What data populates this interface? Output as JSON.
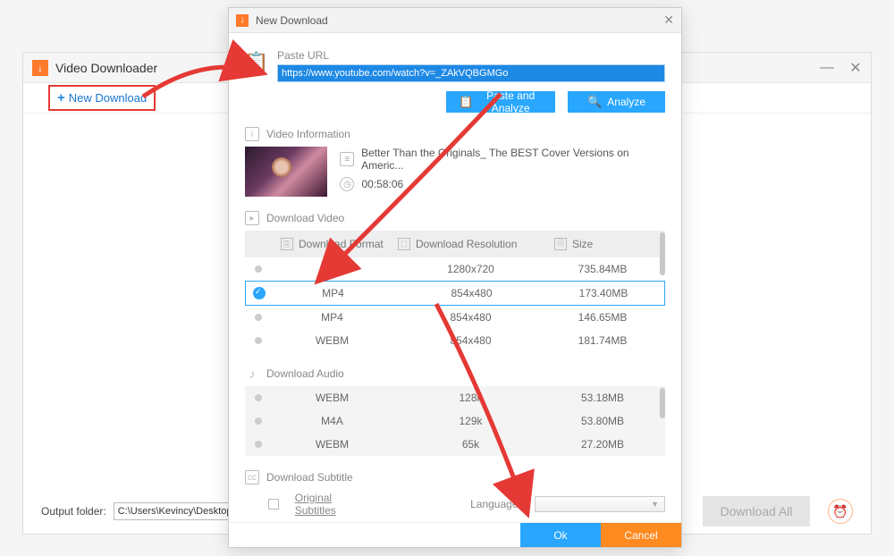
{
  "main": {
    "title": "Video Downloader",
    "newDownloadBtn": "New Download",
    "outputFolderLabel": "Output folder:",
    "outputFolderPath": "C:\\Users\\Kevincy\\Desktop\\Cor",
    "downloadAll": "Download All"
  },
  "dialog": {
    "title": "New Download",
    "pasteUrlLabel": "Paste URL",
    "url": "https://www.youtube.com/watch?v=_ZAkVQBGMGo",
    "pasteAnalyze": "Paste and Analyze",
    "analyze": "Analyze",
    "videoInfoLabel": "Video Information",
    "videoTitle": "Better Than the Originals_ The BEST Cover Versions on Americ...",
    "duration": "00:58:06",
    "downloadVideoLabel": "Download Video",
    "headers": {
      "format": "Download Format",
      "resolution": "Download Resolution",
      "size": "Size"
    },
    "videoRows": [
      {
        "fmt": "MP4",
        "res": "1280x720",
        "size": "735.84MB",
        "selected": false
      },
      {
        "fmt": "MP4",
        "res": "854x480",
        "size": "173.40MB",
        "selected": true
      },
      {
        "fmt": "MP4",
        "res": "854x480",
        "size": "146.65MB",
        "selected": false
      },
      {
        "fmt": "WEBM",
        "res": "854x480",
        "size": "181.74MB",
        "selected": false
      }
    ],
    "downloadAudioLabel": "Download Audio",
    "audioRows": [
      {
        "fmt": "WEBM",
        "res": "128k",
        "size": "53.18MB"
      },
      {
        "fmt": "M4A",
        "res": "129k",
        "size": "53.80MB"
      },
      {
        "fmt": "WEBM",
        "res": "65k",
        "size": "27.20MB"
      }
    ],
    "downloadSubtitleLabel": "Download Subtitle",
    "originalSubtitles": "Original Subtitles",
    "languageLabel": "Language",
    "ok": "Ok",
    "cancel": "Cancel"
  }
}
